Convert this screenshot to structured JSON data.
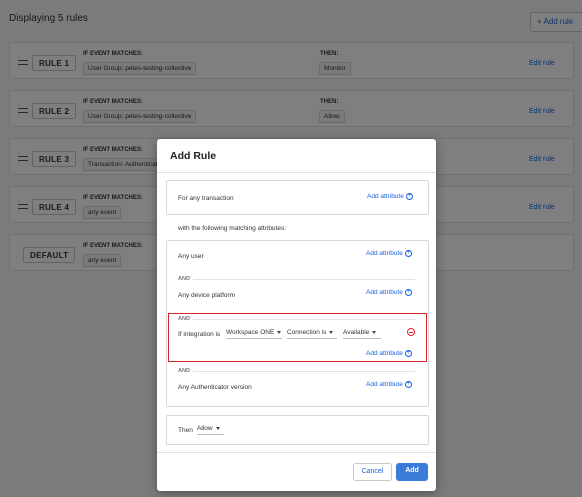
{
  "header": {
    "display_count": "Displaying 5 rules",
    "add_rule_button": "+ Add rule"
  },
  "rules": [
    {
      "label": "RULE 1",
      "if_title": "IF EVENT MATCHES:",
      "condition": "User Group: petes-testing-collective",
      "then_title": "THEN:",
      "then_value": "Monitor",
      "edit": "Edit rule"
    },
    {
      "label": "RULE 2",
      "if_title": "IF EVENT MATCHES:",
      "condition": "User Group: petes-testing-collective",
      "then_title": "THEN:",
      "then_value": "Allow",
      "edit": "Edit rule"
    },
    {
      "label": "RULE 3",
      "if_title": "IF EVENT MATCHES:",
      "condition": "Transaction: Authenticatio",
      "then_title": "",
      "then_value": "",
      "edit": "Edit rule"
    },
    {
      "label": "RULE 4",
      "if_title": "IF EVENT MATCHES:",
      "condition": "any event",
      "then_title": "",
      "then_value": "",
      "edit": "Edit rule"
    },
    {
      "label": "DEFAULT",
      "if_title": "IF EVENT MATCHES:",
      "condition": "any event",
      "then_title": "",
      "then_value": "",
      "edit": ""
    }
  ],
  "modal": {
    "title": "Add Rule",
    "for_any_transaction": "For any transaction",
    "add_attribute": "Add attribute",
    "with_following": "with the following matching attributes:",
    "and_label": "AND",
    "any_user": "Any user",
    "any_device_platform": "Any device platform",
    "integration": {
      "prefix": "If integration is",
      "integration_value": "Workspace ONE",
      "connection_value": "Connection is",
      "status_value": "Available"
    },
    "any_authenticator": "Any Authenticator version",
    "then_label": "Then",
    "then_value": "Allow",
    "cancel": "Cancel",
    "add": "Add"
  },
  "colors": {
    "accent": "#1662dd",
    "primary_button": "#3b7bd8",
    "highlight": "#d9252b"
  }
}
